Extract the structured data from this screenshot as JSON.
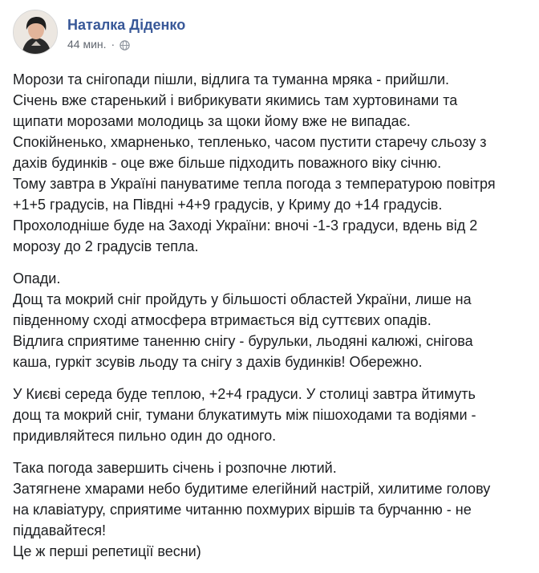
{
  "post": {
    "author": "Наталка Діденко",
    "time": "44 мин.",
    "separator": "·",
    "privacy_icon": "globe-icon",
    "paragraphs": [
      [
        "Морози та снігопади пішли, відлига та туманна мряка - прийшли.",
        "Січень вже старенький і вибрикувати якимись там хуртовинами та",
        "щипати морозами молодиць за щоки йому вже не випадає.",
        "Спокійненько, хмарненько, тепленько, часом пустити старечу сльозу з",
        "дахів будинків - оце вже більше підходить поважного віку січню.",
        "Тому завтра в Україні пануватиме тепла погода з температурою повітря",
        "+1+5 градусів, на Півдні +4+9 градусів, у Криму до +14 градусів.",
        "Прохолодніше буде на Заході України: вночі -1-3 градуси, вдень від 2",
        "морозу до 2 градусів тепла."
      ],
      [
        "Опади.",
        "Дощ та мокрий сніг пройдуть у більшості областей України, лише на",
        "південному сході атмосфера втримається від суттєвих опадів.",
        "Відлига сприятиме таненню снігу - бурульки, льодяні калюжі, снігова",
        "каша, гуркіт зсувів льоду та снігу з дахів будинків! Обережно."
      ],
      [
        "У Києві середа буде теплою, +2+4 градуси. У столиці завтра йтимуть",
        "дощ та мокрий сніг, тумани блукатимуть між пішоходами та водіями -",
        "придивляйтеся пильно один до одного."
      ],
      [
        "Така погода завершить січень і розпочне лютий.",
        "Затягнене хмарами небо будитиме елегійний настрій, хилитиме голову",
        "на клавіатуру, сприятиме читанню похмурих віршів та бурчанню - не",
        "піддавайтеся!",
        "Це ж перші репетиції весни)"
      ]
    ]
  },
  "colors": {
    "author": "#385898",
    "meta": "#616770",
    "text": "#1c1e21",
    "background": "#ffffff"
  }
}
